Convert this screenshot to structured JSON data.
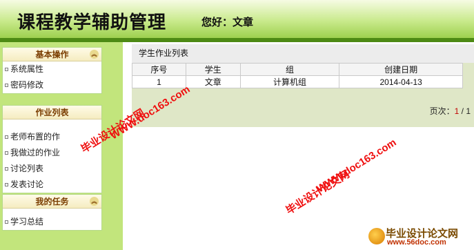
{
  "header": {
    "app_title": "课程教学辅助管理",
    "greeting": "您好：文章"
  },
  "sidebar": {
    "panels": [
      {
        "title": "基本操作",
        "items": [
          "系统属性",
          "密码修改"
        ]
      },
      {
        "title": "作业列表",
        "items": [
          "老师布置的作",
          "我做过的作业",
          "讨论列表",
          "发表讨论"
        ]
      },
      {
        "title": "我的任务",
        "items": [
          "学习总结"
        ]
      }
    ]
  },
  "main": {
    "title": "学生作业列表",
    "columns": [
      "序号",
      "学生",
      "组",
      "创建日期"
    ],
    "rows": [
      [
        "1",
        "文章",
        "计算机组",
        "2014-04-13"
      ]
    ],
    "pager": {
      "label": "页次：",
      "current": "1",
      "separator": " / 1"
    }
  },
  "watermark": {
    "text_cn": "毕业设计论文网",
    "text_url": "WWW.doc163.com"
  },
  "site_badge": {
    "name": "毕业设计论文网",
    "url": "www.56doc.com"
  },
  "colors": {
    "header_top": "#f6fbe3",
    "header_bottom": "#9ed04f",
    "header_bar": "#4d8a14",
    "sidebar_bg": "#c2e57c",
    "panel_title": "#7a3d00",
    "watermark": "#ef1010",
    "pager_current": "#c00000"
  },
  "icons": {
    "panel_toggle": "chevron-up-icon",
    "list_bullet": "square-bullet-icon"
  }
}
